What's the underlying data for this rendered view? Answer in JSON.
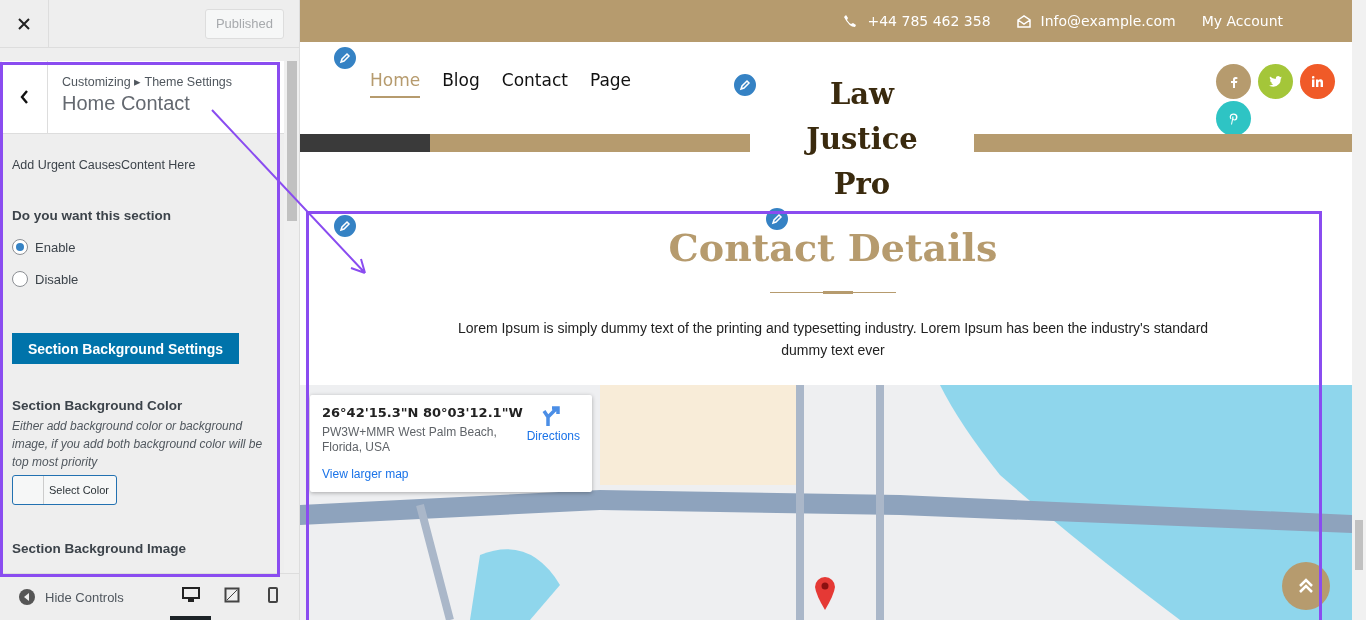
{
  "sidebar": {
    "publish_button": {
      "label": "Published",
      "disabled": true
    },
    "breadcrumb": "Customizing ▸ Theme Settings",
    "title": "Home Contact",
    "description": "Add Urgent CausesContent Here",
    "section_question": "Do you want this section",
    "radios": [
      {
        "label": "Enable",
        "selected": true
      },
      {
        "label": "Disable",
        "selected": false
      }
    ],
    "settings_button": "Section Background Settings",
    "bg_color_label": "Section Background Color",
    "bg_color_hint": "Either add background color or background image, if you add both background color will be top most priority",
    "color_button": "Select Color",
    "bg_image_label": "Section Background Image",
    "hide_controls": "Hide Controls",
    "devices": [
      {
        "kind": "desktop",
        "selected": true
      },
      {
        "kind": "tablet",
        "selected": false
      },
      {
        "kind": "mobile",
        "selected": false
      }
    ]
  },
  "preview": {
    "topbar": {
      "phone": "+44 785 462 358",
      "email": "Info@example.com",
      "account": "My Account"
    },
    "nav": [
      {
        "label": "Home",
        "selected": true
      },
      {
        "label": "Blog",
        "selected": false
      },
      {
        "label": "Contact",
        "selected": false
      },
      {
        "label": "Page",
        "selected": false
      }
    ],
    "logo": "Law Justice Pro",
    "social": [
      {
        "kind": "facebook",
        "color": "#b69b6e"
      },
      {
        "kind": "twitter",
        "color": "#a4c639"
      },
      {
        "kind": "linkedin",
        "color": "#f05a28"
      },
      {
        "kind": "pinterest",
        "color": "#2ec4c4"
      }
    ],
    "contact_title": "Contact Details",
    "contact_text": "Lorem Ipsum is simply dummy text of the printing and typesetting industry. Lorem Ipsum has been the industry's standard dummy text ever",
    "map_card": {
      "coordinates": "26°42'15.3\"N 80°03'12.1\"W",
      "address": "PW3W+MMR West Palm Beach, Florida, USA",
      "directions": "Directions",
      "larger_map": "View larger map"
    }
  }
}
